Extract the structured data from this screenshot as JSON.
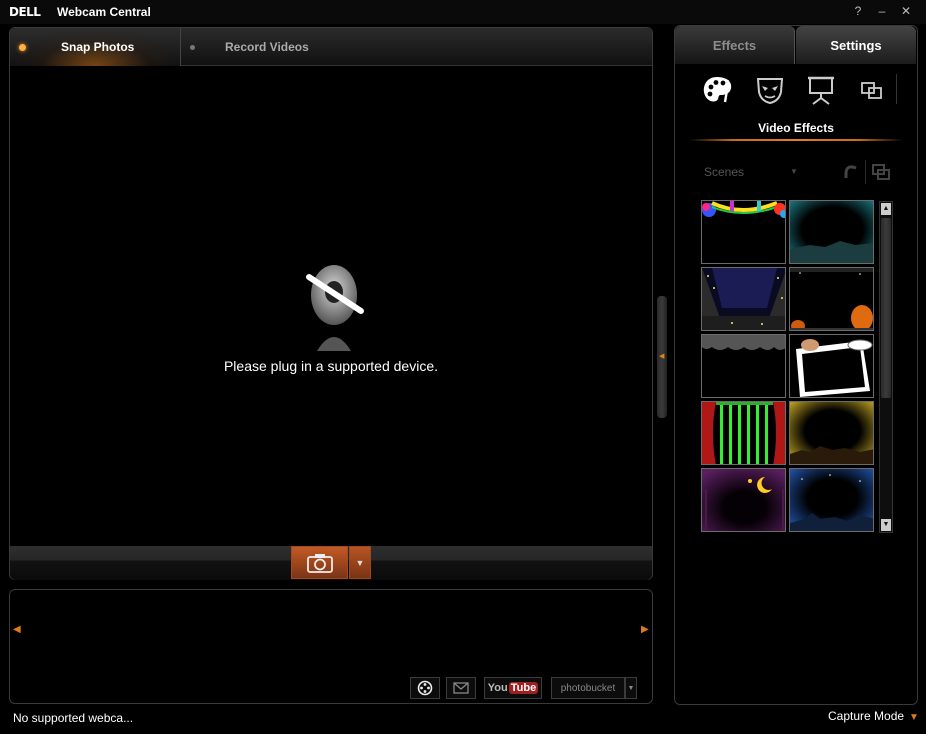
{
  "window": {
    "logo": "DELL",
    "title": "Webcam Central",
    "help": "?",
    "minimize": "–",
    "close": "✕"
  },
  "capture_tabs": [
    {
      "label": "Snap Photos",
      "active": true
    },
    {
      "label": "Record Videos",
      "active": false
    }
  ],
  "viewer": {
    "message": "Please plug in a supported device."
  },
  "status": {
    "text": "No supported webca...",
    "capture_mode": "Capture Mode"
  },
  "share": {
    "youtube_you": "You",
    "youtube_tube": "Tube",
    "photobucket": "photobucket"
  },
  "side_tabs": [
    {
      "label": "Effects",
      "active": true
    },
    {
      "label": "Settings",
      "active": false
    }
  ],
  "effects": {
    "categories": [
      "palette-icon",
      "mask-icon",
      "presentation-icon",
      "overlay-icon"
    ],
    "title": "Video Effects",
    "scenes_label": "Scenes",
    "thumbnails": [
      "party-balloons-scene",
      "city-skyline-teal-scene",
      "starry-stage-scene",
      "halloween-pumpkin-scene",
      "cloud-frame-scene",
      "photo-frame-scene",
      "green-curtain-scene",
      "golden-city-scene",
      "crescent-moon-scene",
      "blue-night-city-scene"
    ]
  },
  "colors": {
    "accent": "#e07b16",
    "background": "#000000",
    "capture_button": "#c25a25"
  }
}
